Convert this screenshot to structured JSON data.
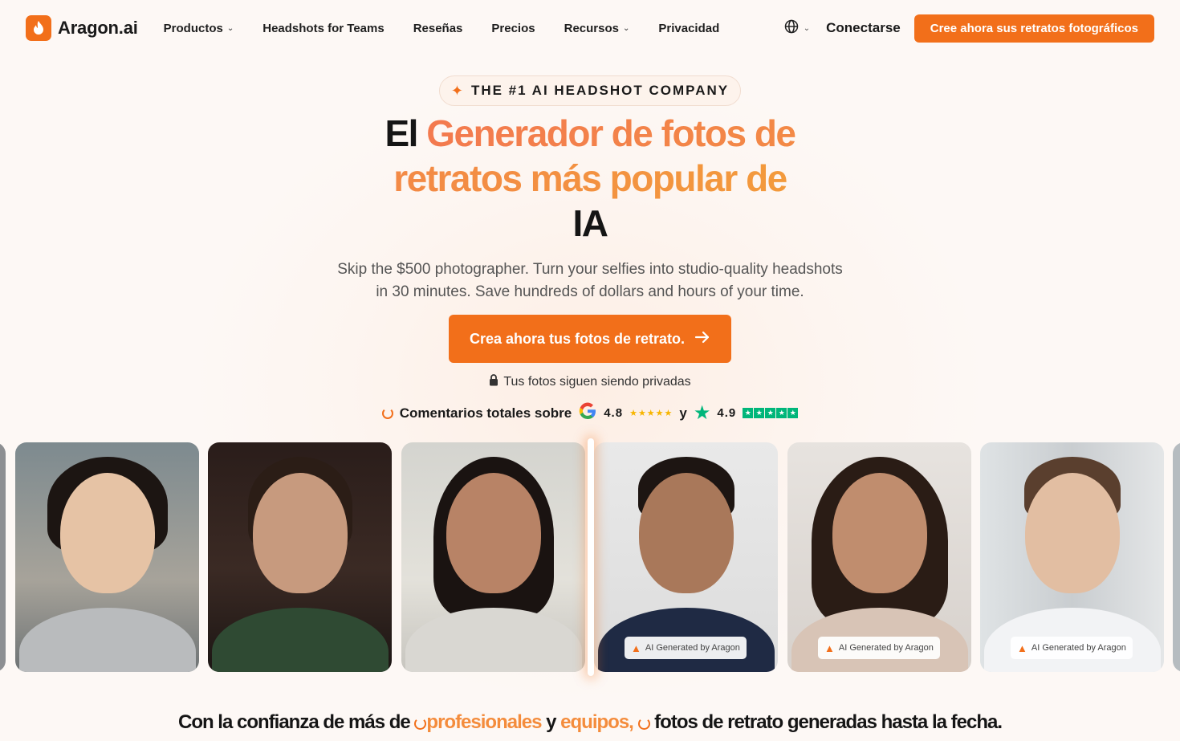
{
  "nav": {
    "logo": "Aragon.ai",
    "items": [
      {
        "label": "Productos",
        "dropdown": true
      },
      {
        "label": "Headshots for Teams",
        "dropdown": false
      },
      {
        "label": "Reseñas",
        "dropdown": false
      },
      {
        "label": "Precios",
        "dropdown": false
      },
      {
        "label": "Recursos",
        "dropdown": true
      },
      {
        "label": "Privacidad",
        "dropdown": false
      }
    ],
    "login": "Conectarse",
    "cta": "Cree ahora sus retratos fotográficos"
  },
  "hero": {
    "badge": "THE #1 AI HEADSHOT COMPANY",
    "title_plain": "El",
    "title_highlight": "Generador de fotos de retratos más popular de",
    "title_end": "IA",
    "subtitle": "Skip the $500 photographer. Turn your selfies into studio-quality headshots in 30 minutes. Save hundreds of dollars and hours of your time.",
    "cta": "Crea ahora tus fotos de retrato.",
    "privacy": "Tus fotos siguen siendo privadas",
    "reviews_label": "Comentarios totales sobre",
    "google_rating": "4.8",
    "connector": "y",
    "trustpilot_rating": "4.9"
  },
  "photos": {
    "ai_badge": "AI Generated by Aragon"
  },
  "trust": {
    "part1": "Con la confianza de más de",
    "professionals": "profesionales",
    "and": "y",
    "teams": "equipos,",
    "part2": "fotos de retrato generadas hasta la fecha."
  },
  "colors": {
    "accent": "#f26f1a",
    "gradient_start": "#f37a4f",
    "gradient_end": "#f39a3c",
    "google_star": "#f7b500",
    "trustpilot": "#00b67a"
  }
}
